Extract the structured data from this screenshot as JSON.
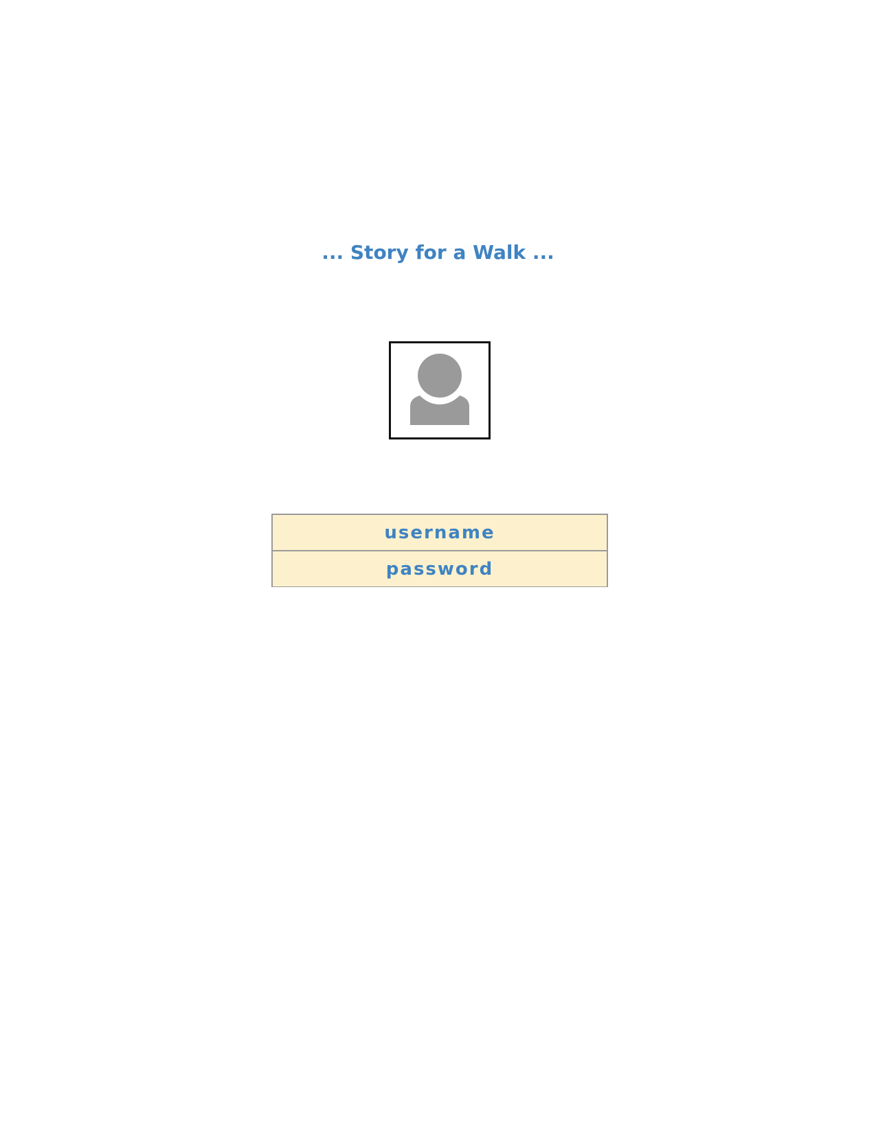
{
  "header": {
    "title": "... Story for a Walk ..."
  },
  "avatar": {
    "icon": "user-silhouette-icon",
    "color": "#9a9a9a"
  },
  "login": {
    "username_placeholder": "username",
    "password_placeholder": "password"
  },
  "colors": {
    "accent": "#3f83c2",
    "field_background": "#fdf1cd",
    "field_border": "#9a9a9a"
  }
}
